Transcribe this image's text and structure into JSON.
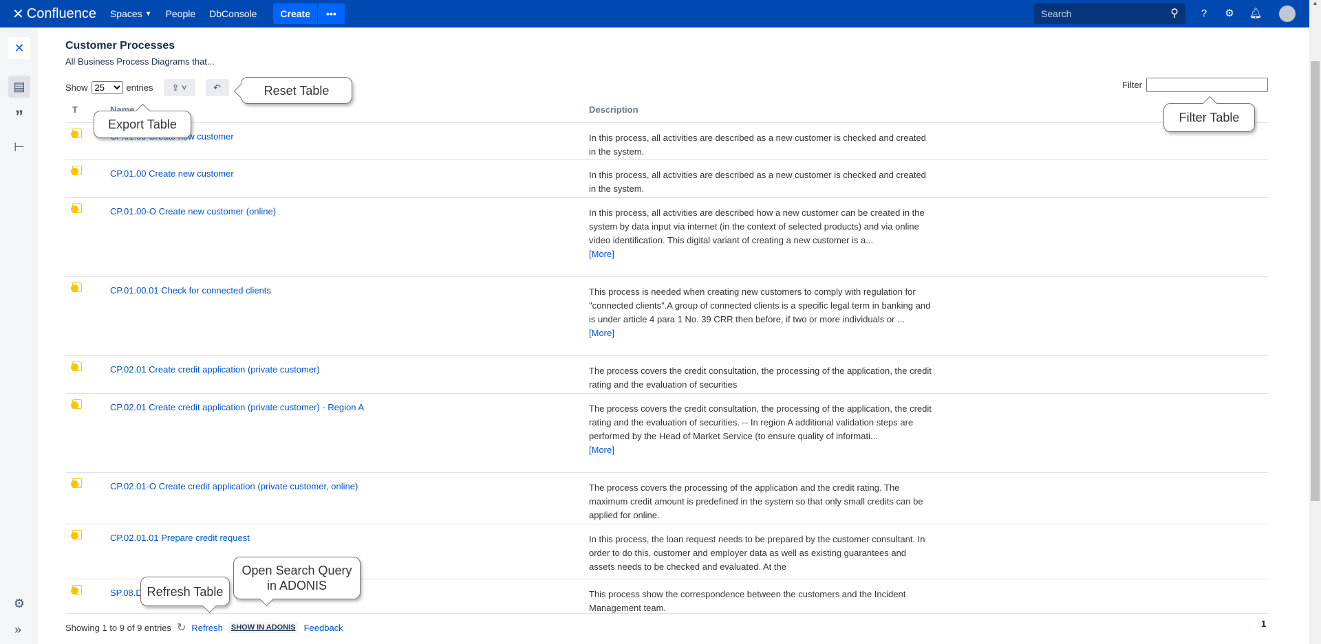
{
  "topbar": {
    "brand": "Confluence",
    "nav": [
      "Spaces",
      "People",
      "DbConsole"
    ],
    "create": "Create",
    "more": "•••",
    "search_placeholder": "Search"
  },
  "page": {
    "title": "Customer Processes",
    "subtitle": "All Business Process Diagrams that...",
    "show": "Show",
    "entries_value": "25",
    "entries": "entries",
    "filter": "Filter",
    "filter_value": ""
  },
  "table": {
    "headers": [
      "T",
      "Name",
      "Description"
    ],
    "rows": [
      {
        "name": "CP.01.00 Create new customer",
        "desc": "In this process, all activities are described as a new customer is checked and created in the system.",
        "more": ""
      },
      {
        "name": "CP.01.00 Create new customer",
        "desc": "In this process, all activities are described as a new customer is checked and created in the system.",
        "more": ""
      },
      {
        "name": "CP.01.00-O Create new customer (online)",
        "desc": "In this process, all activities are described how a new customer can be created in the system by data input via internet (in the context of selected products) and via online video identification.   This digital variant of creating a new customer is a...",
        "more": "[More]"
      },
      {
        "name": "CP.01.00.01 Check for connected clients",
        "desc": "This process is needed when creating new customers to comply with regulation for \"connected clients\".A group of connected clients is a specific legal term in banking and is under article 4 para 1 No. 39 CRR then before, if two or more individuals or ...",
        "more": "[More]"
      },
      {
        "name": "CP.02.01 Create credit application (private customer)",
        "desc": "The process covers the credit consultation, the processing of the application, the credit rating and the evaluation of securities",
        "more": ""
      },
      {
        "name": "CP.02.01 Create credit application (private customer) - Region A",
        "desc": "The process covers the credit consultation, the processing of the application, the credit rating and the evaluation of securities. -- In region A additional validation steps are performed by the Head of Market Service (to ensure quality of informati...",
        "more": "[More]"
      },
      {
        "name": "CP.02.01-O Create credit application (private customer, online)",
        "desc": "The process covers the processing of the application and the credit rating. The maximum credit amount is predefined in the system so that only small credits can be applied for online.",
        "more": ""
      },
      {
        "name": "CP.02.01.01 Prepare credit request",
        "desc": "In this process, the loan request needs to be prepared by the customer consultant. In order to do this, customer and employer data as well as existing guarantees and assets needs to be checked and evaluated. At the",
        "more": ""
      },
      {
        "name": "SP.08.D... with",
        "desc": "This process show the correspondence between the customers and the Incident Management team.",
        "more": ""
      }
    ]
  },
  "footer": {
    "showing": "Showing 1 to 9 of 9 entries",
    "refresh": "Refresh",
    "show_in_adonis": "SHOW IN ADONIS",
    "feedback": "Feedback",
    "page": "1"
  },
  "tooltips": {
    "reset": "Reset Table",
    "export": "Export Table",
    "filter": "Filter Table",
    "refresh": "Refresh Table",
    "adonis": "Open Search Query in ADONIS"
  },
  "colors": {
    "header": "#0049b0",
    "link": "#0052cc",
    "file_icon": "#ffc400"
  }
}
